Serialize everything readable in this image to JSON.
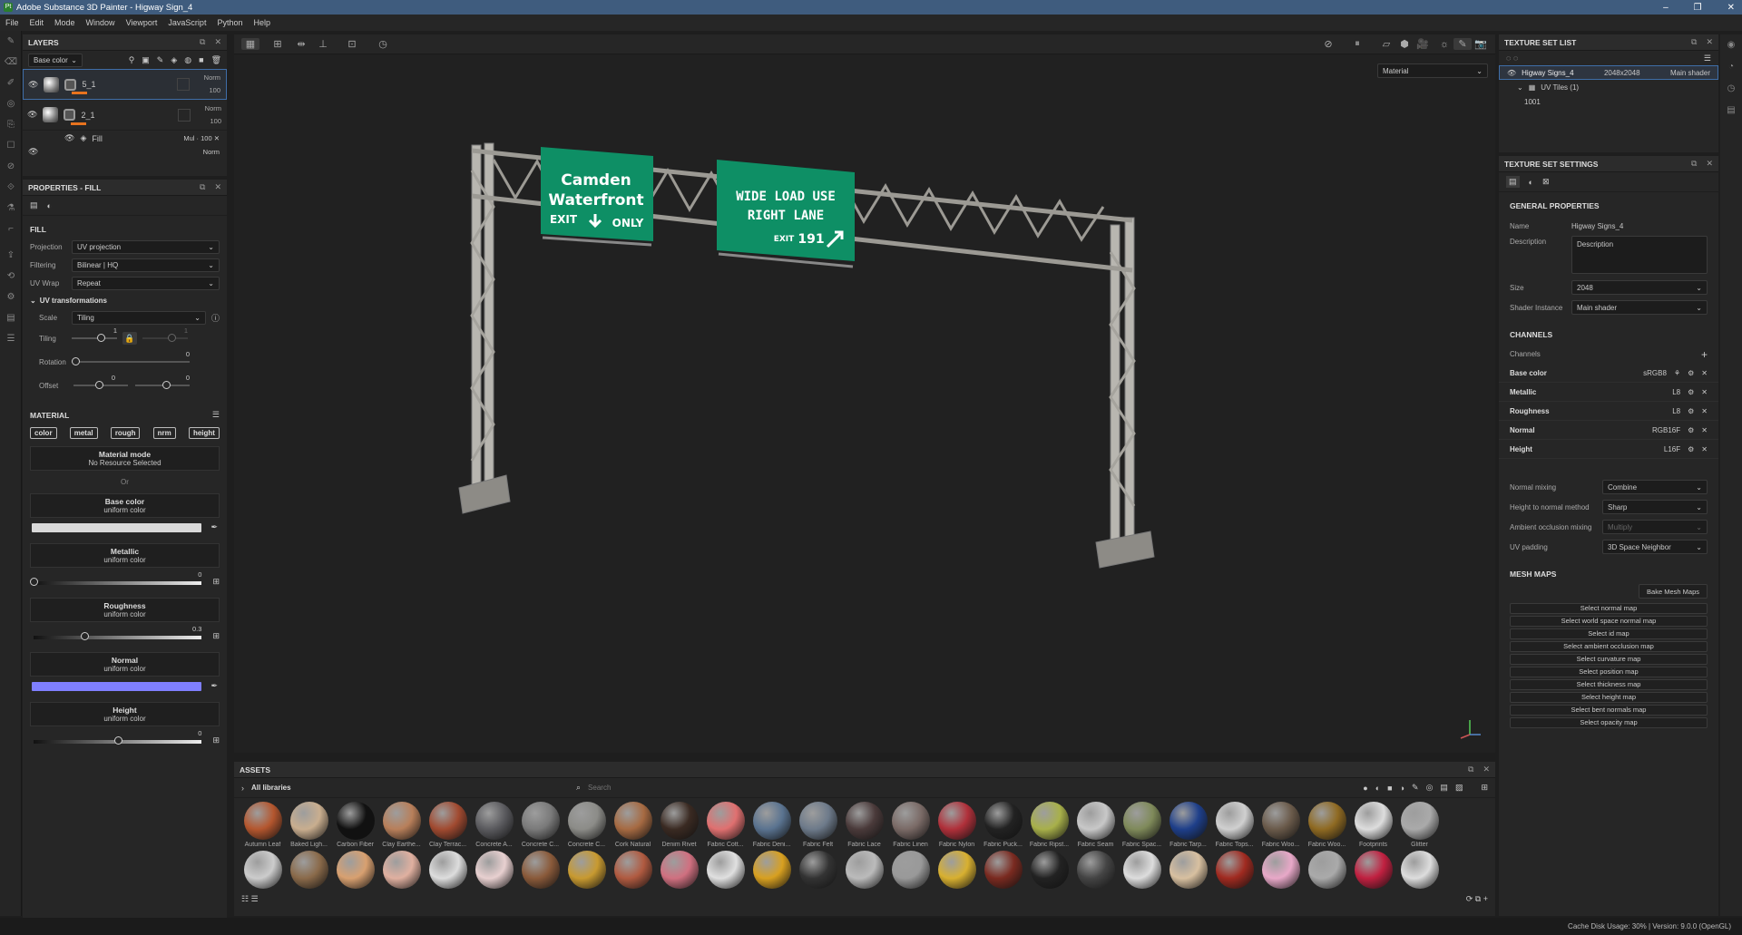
{
  "app": {
    "title": "Adobe Substance 3D Painter - Higway Sign_4"
  },
  "menu": [
    "File",
    "Edit",
    "Mode",
    "Window",
    "Viewport",
    "JavaScript",
    "Python",
    "Help"
  ],
  "layers": {
    "title": "LAYERS",
    "channel_select": "Base color",
    "items": [
      {
        "name": "5_1",
        "blend": "Norm",
        "opacity": "100"
      },
      {
        "name": "2_1",
        "blend": "Norm",
        "opacity": "100"
      },
      {
        "name": "Fill",
        "blend": "Mul",
        "opacity": "100"
      },
      {
        "name": "",
        "blend": "Norm",
        "opacity": ""
      }
    ]
  },
  "properties": {
    "title": "PROPERTIES - FILL",
    "fill_heading": "FILL",
    "projection": {
      "label": "Projection",
      "value": "UV projection"
    },
    "filtering": {
      "label": "Filtering",
      "value": "Bilinear | HQ"
    },
    "uvwrap": {
      "label": "UV Wrap",
      "value": "Repeat"
    },
    "uvtrans": "UV transformations",
    "scale": {
      "label": "Scale",
      "value": "Tiling"
    },
    "tiling": {
      "label": "Tiling",
      "value": "1",
      "right": "1"
    },
    "rotation": {
      "label": "Rotation",
      "value": "0"
    },
    "offset": {
      "label": "Offset",
      "v1": "0",
      "v2": "0"
    },
    "material_heading": "MATERIAL",
    "channel_buttons": [
      "color",
      "metal",
      "rough",
      "nrm",
      "height"
    ],
    "material_mode": {
      "title": "Material mode",
      "sub": "No Resource Selected"
    },
    "or": "Or",
    "base_color": {
      "title": "Base color",
      "sub": "uniform color",
      "color": "#d9d9d9"
    },
    "metallic": {
      "title": "Metallic",
      "sub": "uniform color",
      "value": "0",
      "level": 0
    },
    "roughness": {
      "title": "Roughness",
      "sub": "uniform color",
      "value": "0.3",
      "level": 0.3
    },
    "normal": {
      "title": "Normal",
      "sub": "uniform color",
      "color": "#7f7fff"
    },
    "height": {
      "title": "Height",
      "sub": "uniform color",
      "value": "0",
      "level": 0.5
    }
  },
  "viewport": {
    "mode_select": "Material",
    "sign1": {
      "line1": "Camden",
      "line2": "Waterfront",
      "exit": "EXIT",
      "only": "ONLY"
    },
    "sign2": {
      "line1": "WIDE LOAD USE",
      "line2": "RIGHT LANE",
      "exit": "EXIT",
      "num": "191"
    },
    "sign_color": "#0e8f65"
  },
  "texture_set_list": {
    "title": "TEXTURE SET LIST",
    "set_name": "Higway Signs_4",
    "size": "2048x2048",
    "shader": "Main shader",
    "uv_tiles": "UV Tiles (1)",
    "tile": "1001"
  },
  "texture_set_settings": {
    "title": "TEXTURE SET SETTINGS",
    "general": "GENERAL PROPERTIES",
    "name": {
      "label": "Name",
      "value": "Higway Signs_4"
    },
    "description": {
      "label": "Description",
      "value": "Description"
    },
    "size": {
      "label": "Size",
      "value": "2048"
    },
    "shader": {
      "label": "Shader Instance",
      "value": "Main shader"
    },
    "channels_heading": "CHANNELS",
    "channels_label": "Channels",
    "channels": [
      {
        "name": "Base color",
        "format": "sRGB8"
      },
      {
        "name": "Metallic",
        "format": "L8"
      },
      {
        "name": "Roughness",
        "format": "L8"
      },
      {
        "name": "Normal",
        "format": "RGB16F"
      },
      {
        "name": "Height",
        "format": "L16F"
      }
    ],
    "normal_mixing": {
      "label": "Normal mixing",
      "value": "Combine"
    },
    "height_to_normal": {
      "label": "Height to normal method",
      "value": "Sharp"
    },
    "ao_mixing": {
      "label": "Ambient occlusion mixing",
      "value": "Multiply"
    },
    "uv_padding": {
      "label": "UV padding",
      "value": "3D Space Neighbor"
    },
    "mesh_maps_heading": "MESH MAPS",
    "bake_button": "Bake Mesh Maps",
    "maps": [
      "Select normal map",
      "Select world space normal map",
      "Select id map",
      "Select ambient occlusion map",
      "Select curvature map",
      "Select position map",
      "Select thickness map",
      "Select height map",
      "Select bent normals map",
      "Select opacity map"
    ]
  },
  "assets": {
    "title": "ASSETS",
    "library": "All libraries",
    "search_placeholder": "Search",
    "row1": [
      {
        "name": "Autumn Leaf",
        "color": "#b4562e"
      },
      {
        "name": "Baked Ligh...",
        "color": "#c9ae8f"
      },
      {
        "name": "Carbon Fiber",
        "color": "#111111"
      },
      {
        "name": "Clay Earthe...",
        "color": "#b87f5a"
      },
      {
        "name": "Clay Terrac...",
        "color": "#a14a30"
      },
      {
        "name": "Concrete A...",
        "color": "#5a5a5e"
      },
      {
        "name": "Concrete C...",
        "color": "#7a7a7a"
      },
      {
        "name": "Concrete C...",
        "color": "#8c8c88"
      },
      {
        "name": "Cork Natural",
        "color": "#a66a42"
      },
      {
        "name": "Denim Rivet",
        "color": "#3a2a22"
      },
      {
        "name": "Fabric Cott...",
        "color": "#e07070"
      },
      {
        "name": "Fabric Deni...",
        "color": "#5a7390"
      },
      {
        "name": "Fabric Felt",
        "color": "#6d7a8a"
      },
      {
        "name": "Fabric Lace",
        "color": "#4a3a3a"
      },
      {
        "name": "Fabric Linen",
        "color": "#7a6a66"
      },
      {
        "name": "Fabric Nylon",
        "color": "#b0303a"
      },
      {
        "name": "Fabric Puck...",
        "color": "#222222"
      },
      {
        "name": "Fabric Ripst...",
        "color": "#a8b04a"
      },
      {
        "name": "Fabric Seam",
        "color": "#c8c8c8"
      },
      {
        "name": "Fabric Spac...",
        "color": "#7f8a5a"
      },
      {
        "name": "Fabric Tarp...",
        "color": "#1e3f8a"
      },
      {
        "name": "Fabric Tops...",
        "color": "#d0d0d0"
      },
      {
        "name": "Fabric Woo...",
        "color": "#6a5a4a"
      },
      {
        "name": "Fabric Woo...",
        "color": "#8f6a22"
      },
      {
        "name": "Footprints",
        "color": "#dddddd"
      },
      {
        "name": "Glitter",
        "color": "#aaaaaa"
      }
    ],
    "row2": [
      "#cccccc",
      "#8a6a4a",
      "#d8a070",
      "#e0b0a0",
      "#dddddd",
      "#e8d0d0",
      "#8a5a3a",
      "#c89a30",
      "#b05a40",
      "#d07080",
      "#e0e0e0",
      "#d8a020",
      "#333333",
      "#bbbbbb",
      "#999999",
      "#d8b030",
      "#7a2a20",
      "#222222",
      "#444444",
      "#dddddd",
      "#d8c0a0",
      "#a02a20",
      "#e8a8c8",
      "#aaaaaa",
      "#c02040",
      "#dddddd"
    ]
  },
  "status": {
    "text": "Cache Disk Usage:   30% | Version: 9.0.0 (OpenGL)"
  }
}
